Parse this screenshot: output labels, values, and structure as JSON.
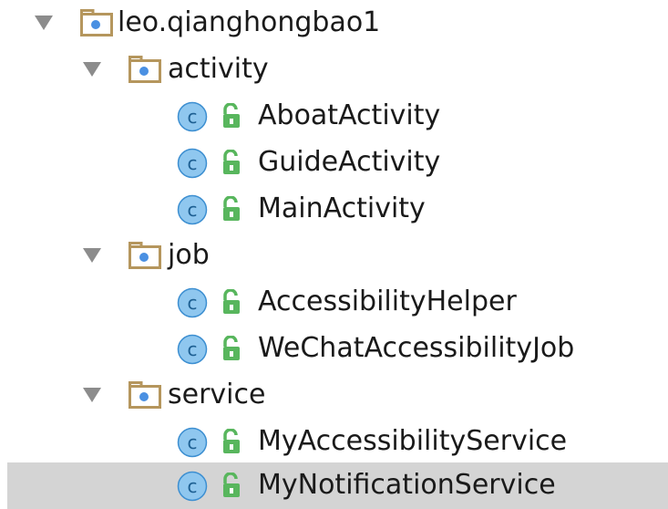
{
  "project_tree": {
    "root": {
      "label": "leo.qianghongbao1",
      "icon": "package-folder-icon",
      "expanded": true
    },
    "packages": [
      {
        "label": "activity",
        "icon": "package-folder-icon",
        "expanded": true,
        "classes": [
          {
            "label": "AboatActivity",
            "icon": "class-icon",
            "access": "public"
          },
          {
            "label": "GuideActivity",
            "icon": "class-icon",
            "access": "public"
          },
          {
            "label": "MainActivity",
            "icon": "class-icon",
            "access": "public"
          }
        ]
      },
      {
        "label": "job",
        "icon": "package-folder-icon",
        "expanded": true,
        "classes": [
          {
            "label": "AccessibilityHelper",
            "icon": "class-icon",
            "access": "public"
          },
          {
            "label": "WeChatAccessibilityJob",
            "icon": "class-icon",
            "access": "public"
          }
        ]
      },
      {
        "label": "service",
        "icon": "package-folder-icon",
        "expanded": true,
        "classes": [
          {
            "label": "MyAccessibilityService",
            "icon": "class-icon",
            "access": "public"
          },
          {
            "label": "MyNotificationService",
            "icon": "class-icon",
            "access": "public",
            "selected": true
          }
        ]
      }
    ]
  },
  "colors": {
    "selection": "#d4d4d4",
    "folder_outline": "#b5965d",
    "package_dot": "#4a90e2",
    "class_circle": "#8fc7ef",
    "class_letter": "#1d5f92",
    "lock": "#58b65d",
    "arrow": "#8c8c8c"
  }
}
